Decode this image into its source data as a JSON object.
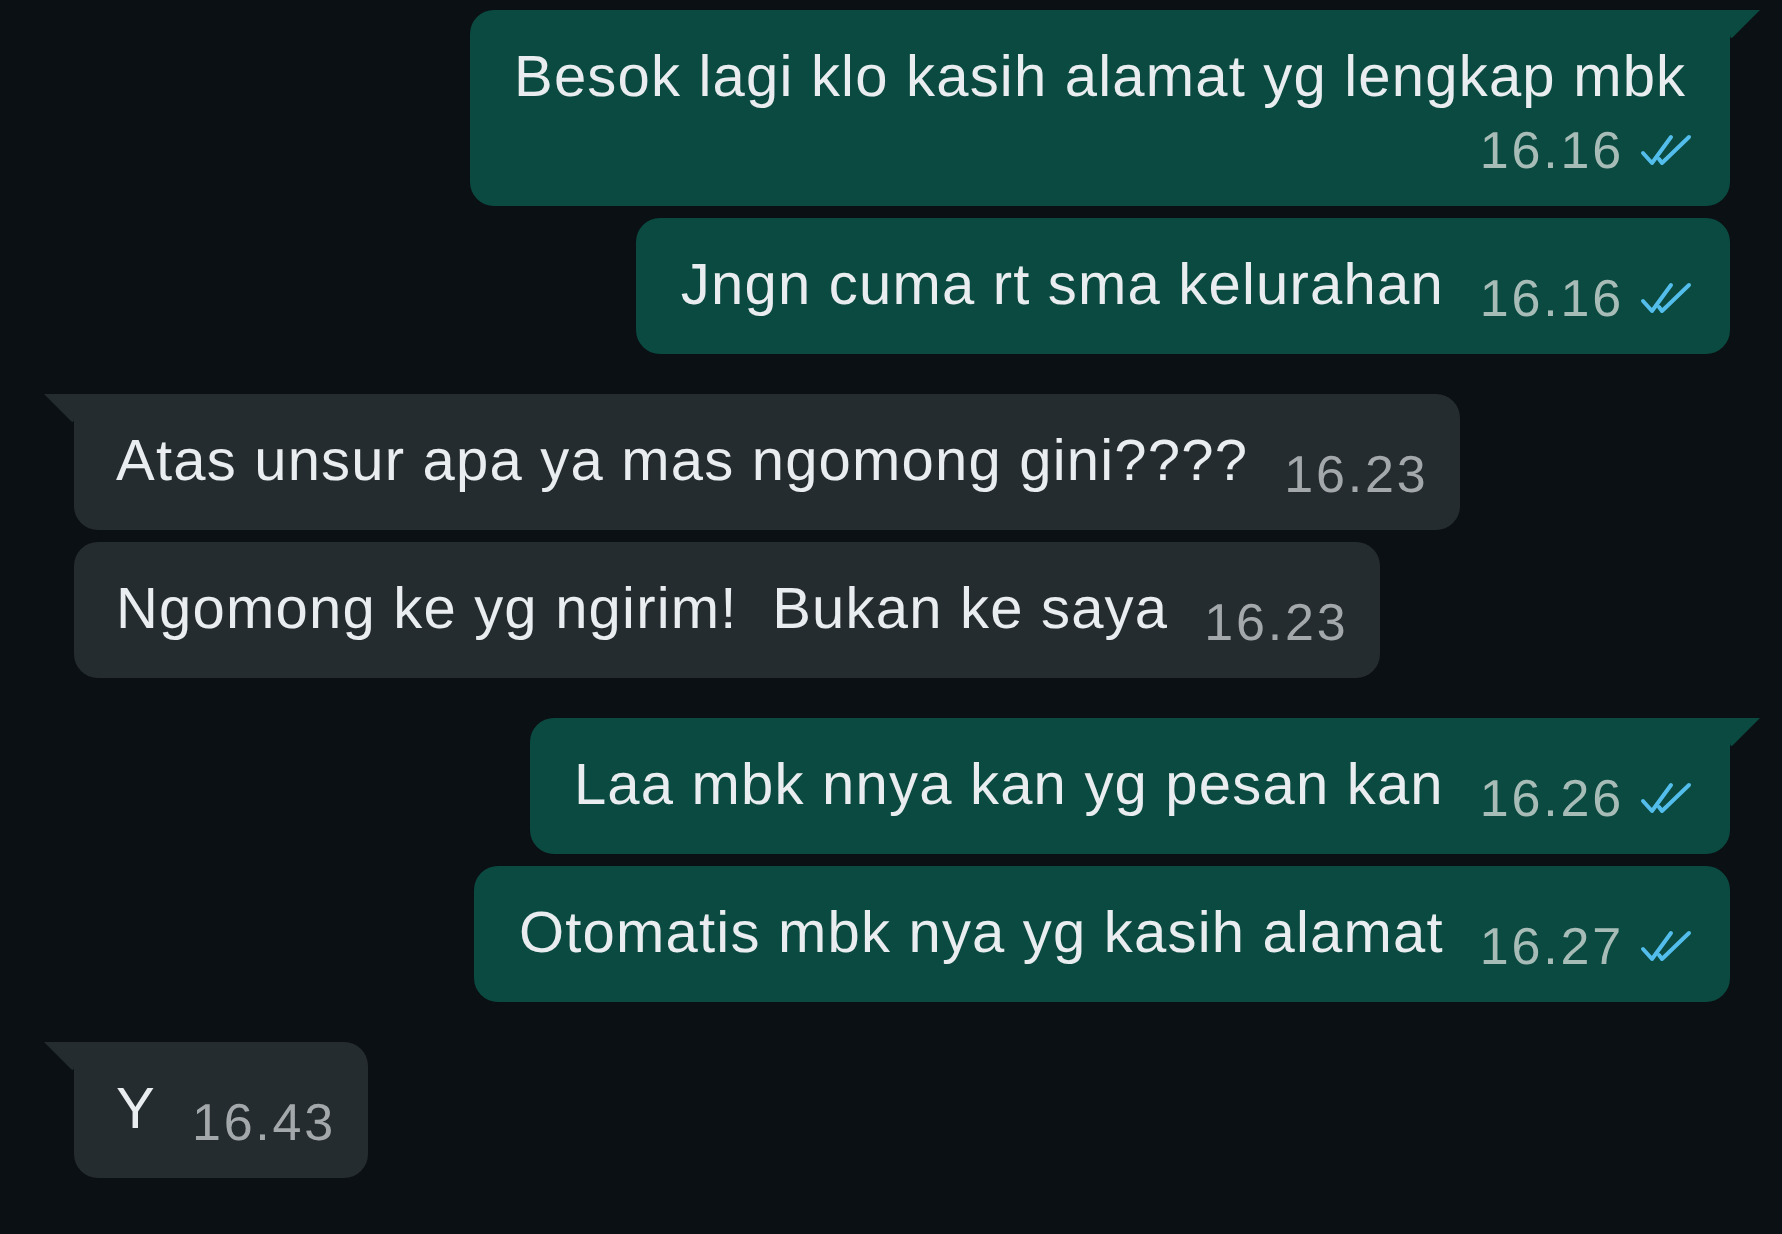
{
  "messages": [
    {
      "kind": "outgoing",
      "tail": true,
      "text": "Besok lagi klo kasih alamat yg lengkap mbk",
      "time": "16.16",
      "read": true
    },
    {
      "kind": "outgoing",
      "tail": false,
      "text": "Jngn cuma rt sma kelurahan",
      "time": "16.16",
      "read": true
    },
    {
      "kind": "incoming",
      "tail": true,
      "text": "Atas unsur apa ya mas ngomong gini????",
      "time": "16.23"
    },
    {
      "kind": "incoming",
      "tail": false,
      "text": "Ngomong ke yg ngirim!  Bukan ke saya",
      "time": "16.23"
    },
    {
      "kind": "outgoing",
      "tail": true,
      "text": "Laa mbk nnya kan yg pesan kan",
      "time": "16.26",
      "read": true
    },
    {
      "kind": "outgoing",
      "tail": false,
      "text": "Otomatis mbk nya yg kasih alamat",
      "time": "16.27",
      "read": true
    },
    {
      "kind": "incoming",
      "tail": true,
      "text": "Y",
      "time": "16.43"
    }
  ]
}
